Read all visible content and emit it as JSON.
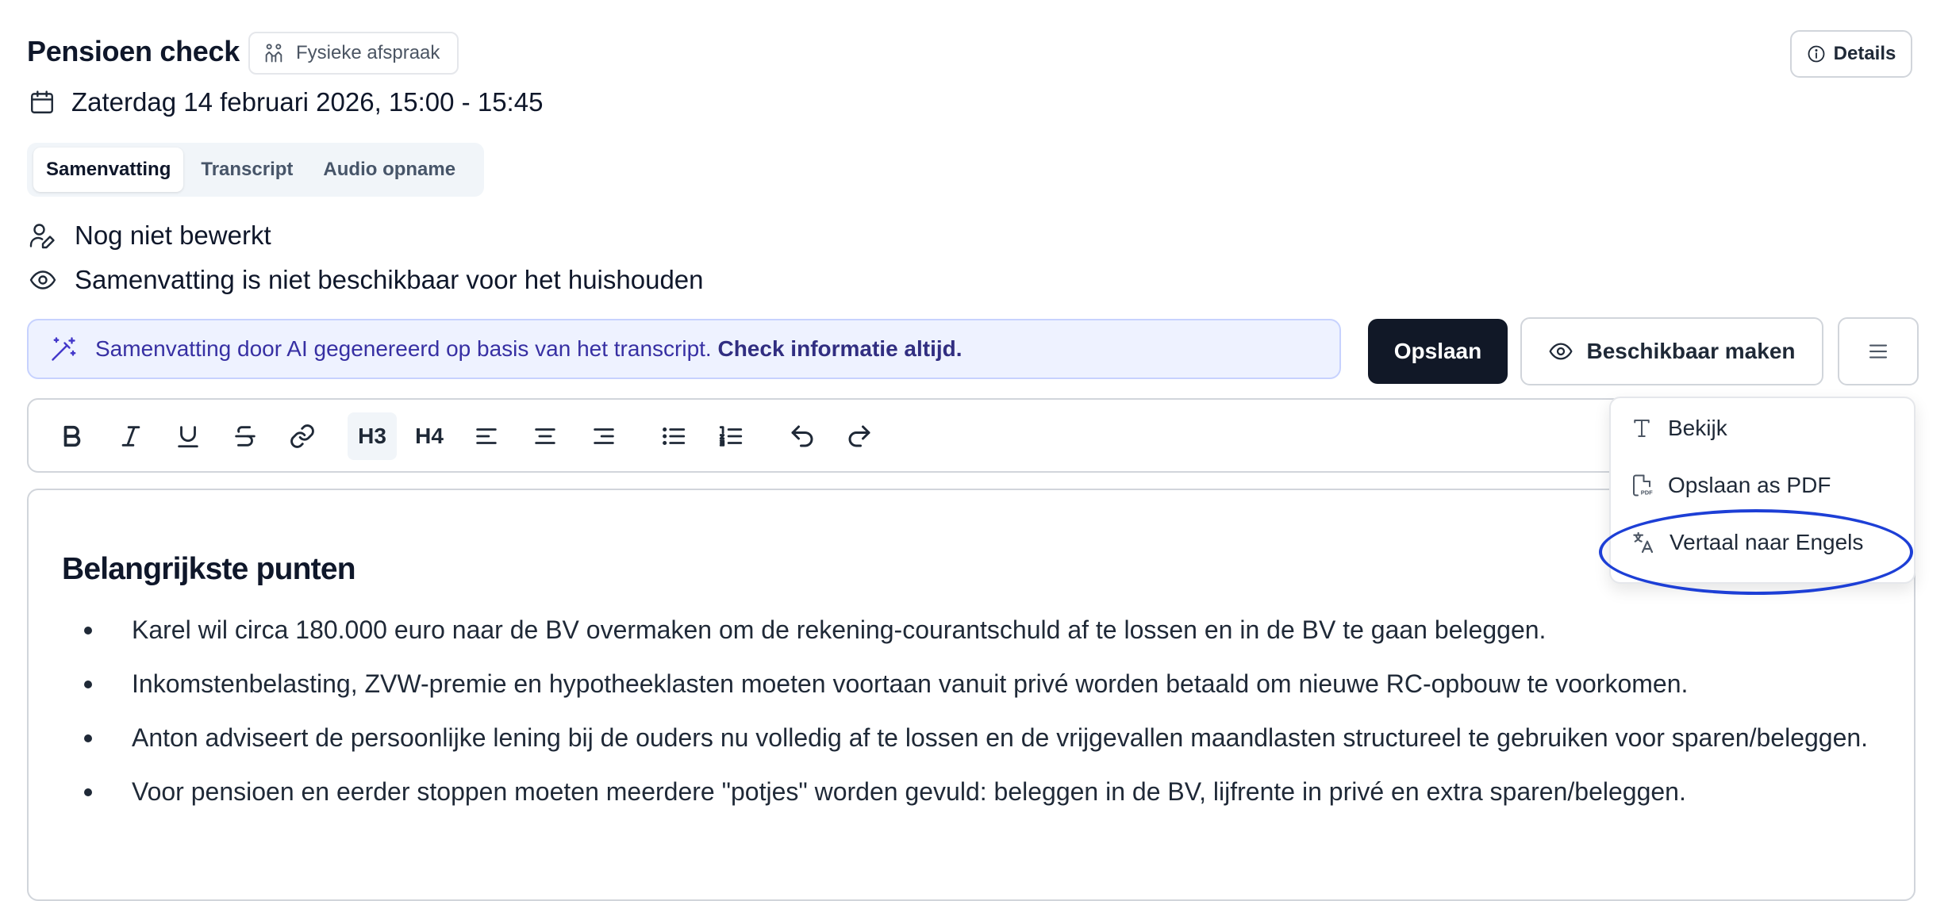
{
  "header": {
    "title": "Pensioen check",
    "meeting_type": "Fysieke afspraak",
    "details_label": "Details",
    "datetime": "Zaterdag 14 februari 2026, 15:00 - 15:45"
  },
  "tabs": [
    {
      "label": "Samenvatting",
      "active": true
    },
    {
      "label": "Transcript",
      "active": false
    },
    {
      "label": "Audio opname",
      "active": false
    }
  ],
  "status": {
    "edit_status": "Nog niet bewerkt",
    "visibility_status": "Samenvatting is niet beschikbaar voor het huishouden"
  },
  "ai_banner": {
    "text": "Samenvatting door AI gegenereerd op basis van het transcript.",
    "emphasis": "Check informatie altijd."
  },
  "actions": {
    "save_label": "Opslaan",
    "publish_label": "Beschikbaar maken"
  },
  "toolbar": {
    "h3_label": "H3",
    "h4_label": "H4",
    "active_heading": "H3"
  },
  "editor": {
    "heading": "Belangrijkste punten",
    "bullets": [
      "Karel wil circa 180.000 euro naar de BV overmaken om de rekening-courantschuld af te lossen en in de BV te gaan beleggen.",
      "Inkomstenbelasting, ZVW-premie en hypotheeklasten moeten voortaan vanuit privé worden betaald om nieuwe RC-opbouw te voorkomen.",
      "Anton adviseert de persoonlijke lening bij de ouders nu volledig af te lossen en de vrijgevallen maandlasten structureel te gebruiken voor sparen/beleggen.",
      "Voor pensioen en eerder stoppen moeten meerdere \"potjes\" worden gevuld: beleggen in de BV, lijfrente in privé en extra sparen/beleggen."
    ]
  },
  "dropdown": {
    "items": [
      {
        "label": "Bekijk",
        "icon": "type-icon"
      },
      {
        "label": "Opslaan as PDF",
        "icon": "pdf-file-icon"
      },
      {
        "label": "Vertaal naar Engels",
        "icon": "translate-icon",
        "highlighted": true
      }
    ]
  },
  "colors": {
    "banner_bg": "#eef2ff",
    "banner_text": "#3730a3",
    "primary_button": "#111827",
    "highlight_ring": "#1d3fd6"
  }
}
